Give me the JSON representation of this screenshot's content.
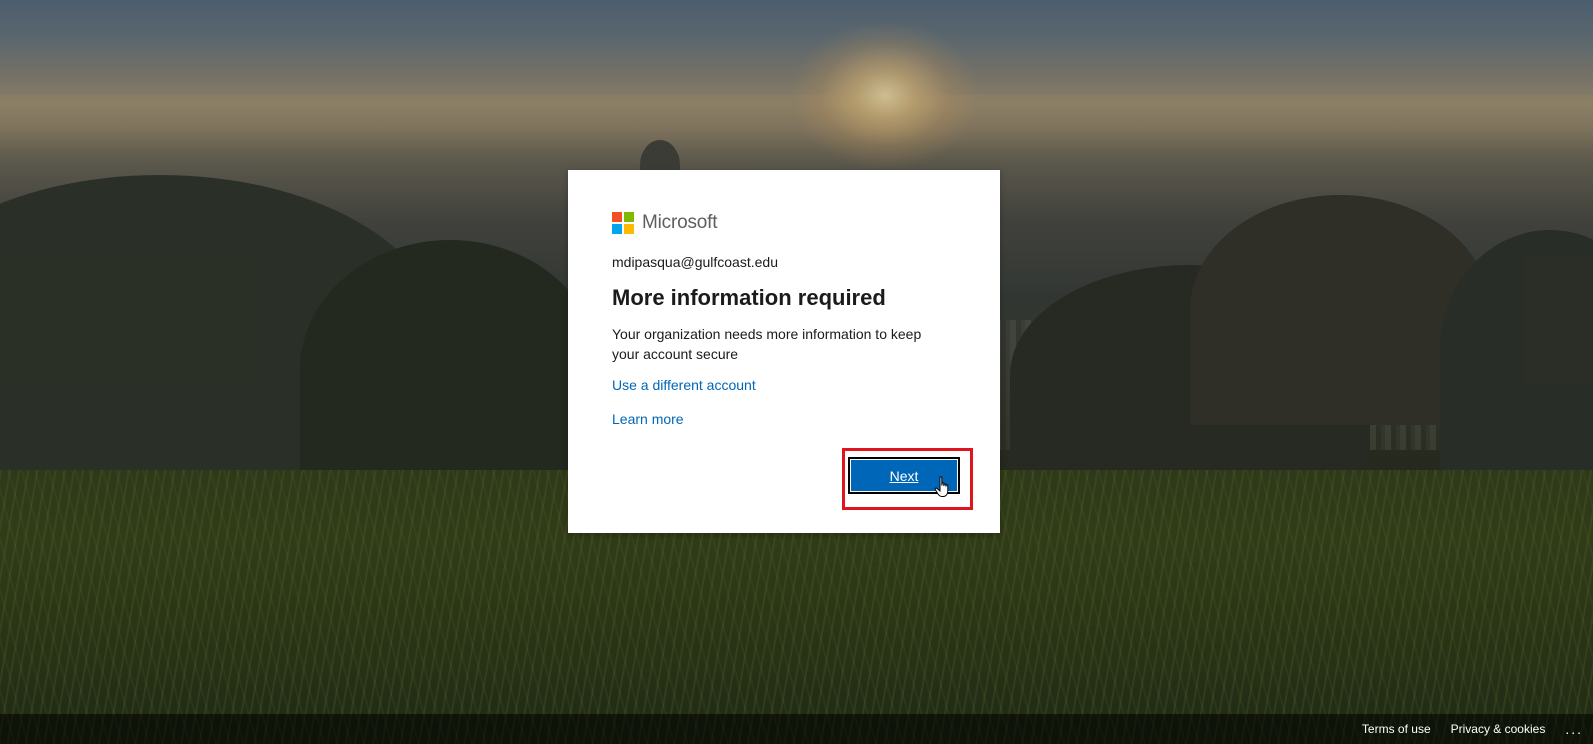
{
  "brand": {
    "name": "Microsoft"
  },
  "card": {
    "identity": "mdipasqua@gulfcoast.edu",
    "title": "More information required",
    "description": "Your organization needs more information to keep your account secure",
    "use_different_account": "Use a different account",
    "learn_more": "Learn more",
    "next_label": "Next"
  },
  "footer": {
    "terms": "Terms of use",
    "privacy": "Privacy & cookies",
    "more": "..."
  },
  "colors": {
    "accent": "#0067b8",
    "highlight_border": "#e0141e",
    "logo_red": "#f25022",
    "logo_green": "#7fba00",
    "logo_blue": "#00a4ef",
    "logo_yellow": "#ffb900"
  },
  "icons": {
    "logo": "microsoft-logo-icon",
    "cursor": "hand-pointer-icon",
    "more": "ellipsis-icon"
  }
}
